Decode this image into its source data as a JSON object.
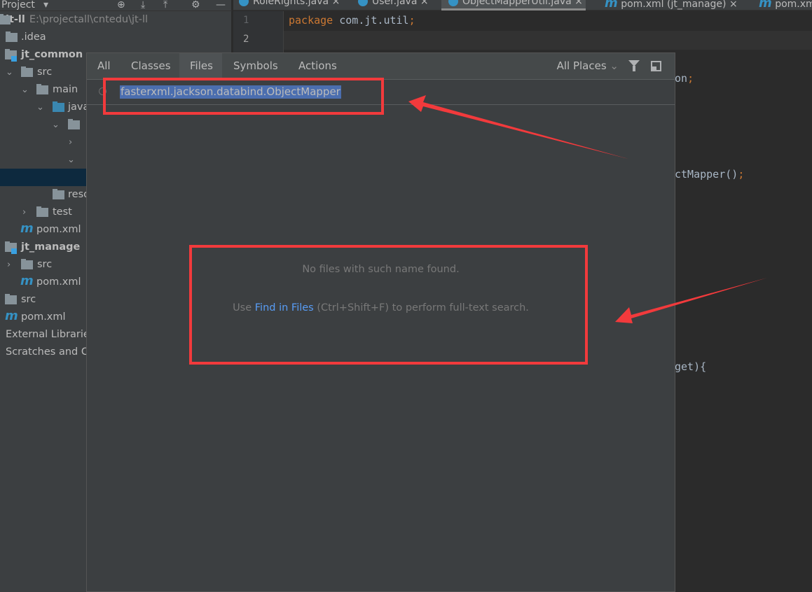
{
  "sidebar": {
    "header": "Project",
    "root": {
      "name": "jt-ll",
      "path": "E:\\projectall\\cntedu\\jt-ll"
    },
    "items": [
      {
        "label": ".idea"
      },
      {
        "label": "jt_common"
      },
      {
        "label": "src"
      },
      {
        "label": "main"
      },
      {
        "label": "java"
      },
      {
        "label": "resources"
      },
      {
        "label": "test"
      },
      {
        "label": "pom.xml"
      },
      {
        "label": "jt_manage"
      },
      {
        "label": "src"
      },
      {
        "label": "pom.xml"
      },
      {
        "label": "src"
      },
      {
        "label": "pom.xml"
      },
      {
        "label": "External Libraries"
      },
      {
        "label": "Scratches and Consoles"
      }
    ]
  },
  "editor_tabs": [
    {
      "label": "RoleRights.java",
      "icon": "class-icon"
    },
    {
      "label": "User.java",
      "icon": "class-icon"
    },
    {
      "label": "ObjectMapperUtil.java",
      "icon": "class-icon",
      "active": true
    },
    {
      "label": "pom.xml (jt_manage)",
      "icon": "maven-icon"
    },
    {
      "label": "pom.xml",
      "icon": "maven-icon"
    }
  ],
  "editor": {
    "line_numbers": [
      "1",
      "2"
    ],
    "line1_keyword": "package",
    "line1_rest": " com.jt.util",
    "frag_on": "on",
    "frag_mapper": "ctMapper()",
    "frag_get": "get){",
    "semicolon": ";"
  },
  "popup": {
    "tabs": [
      "All",
      "Classes",
      "Files",
      "Symbols",
      "Actions"
    ],
    "active_tab": "Files",
    "scope": "All Places",
    "search_value": "fasterxml.jackson.databind.ObjectMapper",
    "empty_message": "No files with such name found.",
    "hint_prefix": "Use ",
    "hint_link": "Find in Files",
    "hint_suffix": " (Ctrl+Shift+F) to perform full-text search."
  },
  "annotation_color": "#f23a3c"
}
